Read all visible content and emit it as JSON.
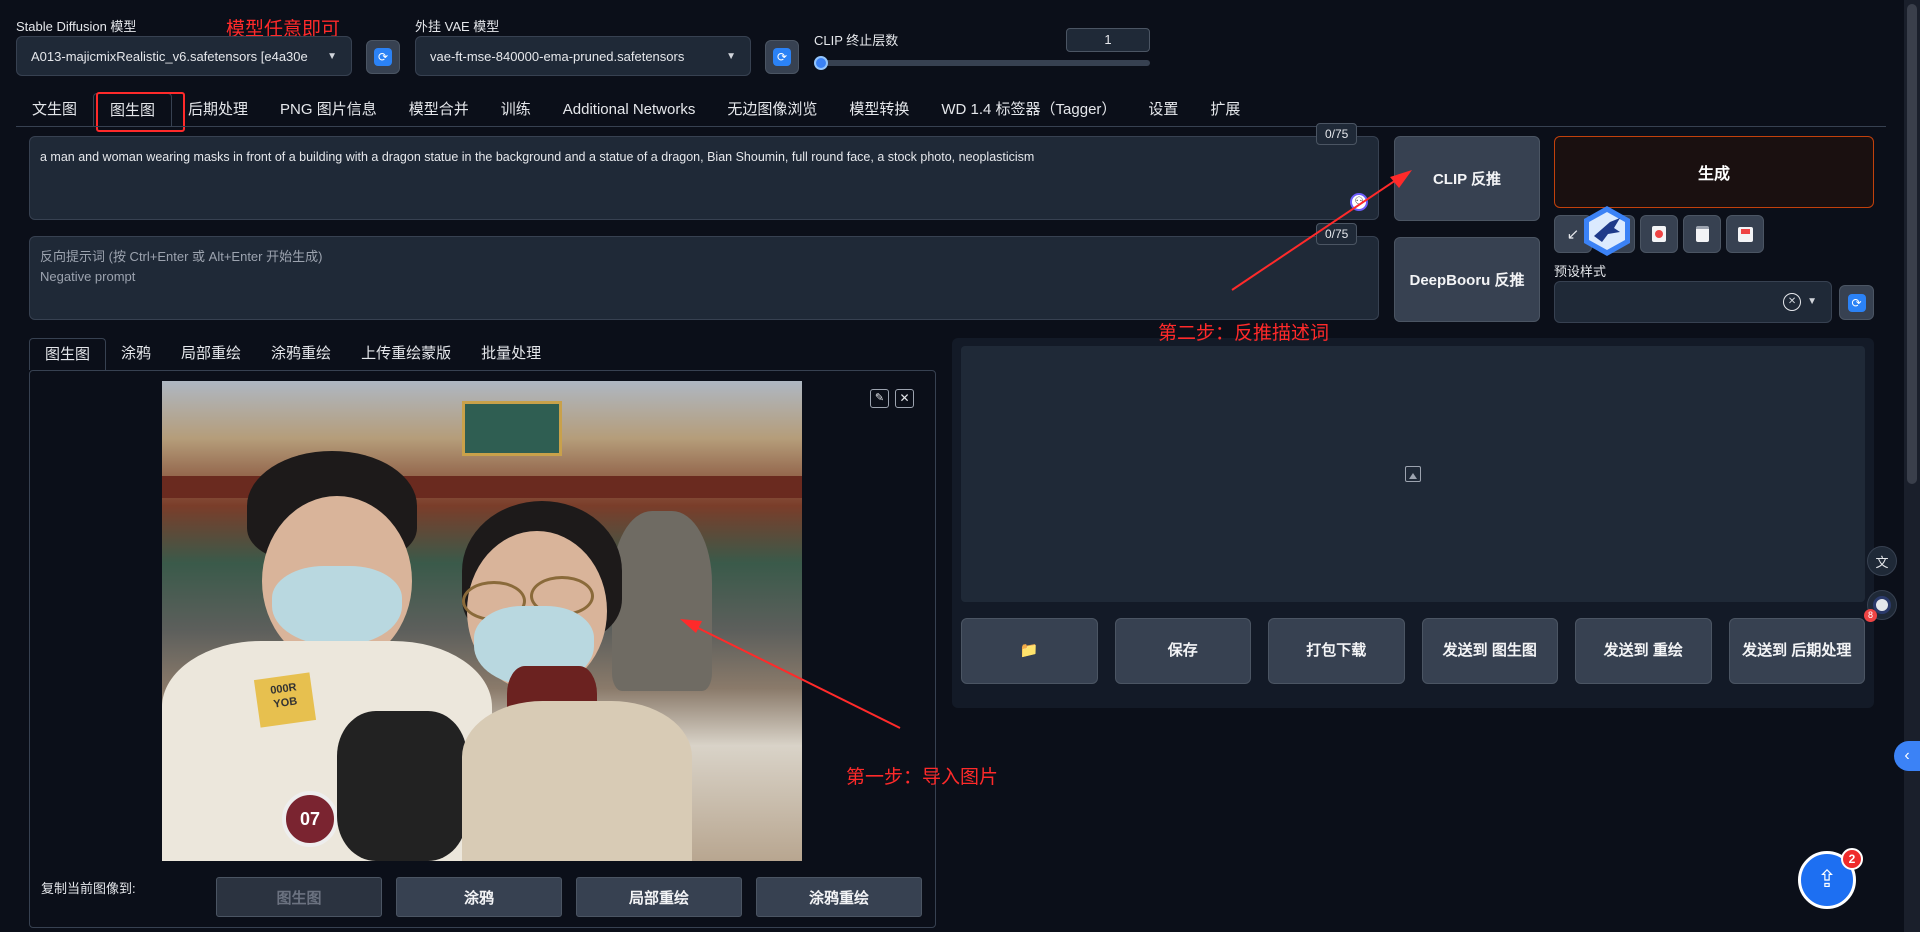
{
  "model": {
    "sd_label": "Stable Diffusion 模型",
    "sd_value": "A013-majicmixRealistic_v6.safetensors [e4a30e",
    "vae_label": "外挂 VAE 模型",
    "vae_value": "vae-ft-mse-840000-ema-pruned.safetensors",
    "clip_label": "CLIP 终止层数",
    "clip_value": "1",
    "clip_slider_fraction": 0.0
  },
  "annotations": {
    "model_note": "模型任意即可",
    "step1": "第一步：导入图片",
    "step2": "第二步：反推描述词"
  },
  "tabs": [
    {
      "label": "文生图"
    },
    {
      "label": "图生图"
    },
    {
      "label": "后期处理"
    },
    {
      "label": "PNG 图片信息"
    },
    {
      "label": "模型合并"
    },
    {
      "label": "训练"
    },
    {
      "label": "Additional Networks"
    },
    {
      "label": "无边图像浏览"
    },
    {
      "label": "模型转换"
    },
    {
      "label": "WD 1.4 标签器（Tagger）"
    },
    {
      "label": "设置"
    },
    {
      "label": "扩展"
    }
  ],
  "prompt": {
    "text": "a man and woman wearing masks in front of a building with a dragon statue in the background and a statue of a dragon, Bian Shoumin, full round face, a stock photo, neoplasticism",
    "counter": "0/75"
  },
  "negative": {
    "placeholder_line1": "反向提示词 (按 Ctrl+Enter 或 Alt+Enter 开始生成)",
    "placeholder_line2": "Negative prompt",
    "counter": "0/75"
  },
  "buttons": {
    "clip_interrogate": "CLIP 反推",
    "deepbooru_interrogate": "DeepBooru 反推",
    "generate": "生成"
  },
  "tools": {
    "icons": [
      "arrow-icon",
      "trash-icon",
      "picture-icon",
      "clipboard-icon",
      "save-icon"
    ],
    "style_label": "预设样式",
    "clear_symbol": "✕"
  },
  "subtabs": [
    {
      "label": "图生图"
    },
    {
      "label": "涂鸦"
    },
    {
      "label": "局部重绘"
    },
    {
      "label": "涂鸦重绘"
    },
    {
      "label": "上传重绘蒙版"
    },
    {
      "label": "批量处理"
    }
  ],
  "output_buttons": [
    {
      "label": "📁",
      "icon": "folder-icon"
    },
    {
      "label": "保存"
    },
    {
      "label": "打包下载"
    },
    {
      "label": "发送到 图生图"
    },
    {
      "label": "发送到 重绘"
    },
    {
      "label": "发送到 后期处理"
    }
  ],
  "copy_to": {
    "label": "复制当前图像到:",
    "buttons": [
      {
        "label": "图生图",
        "disabled": true
      },
      {
        "label": "涂鸦",
        "disabled": false
      },
      {
        "label": "局部重绘",
        "disabled": false
      },
      {
        "label": "涂鸦重绘",
        "disabled": false
      }
    ]
  },
  "photo": {
    "jacket_text_1": "000R",
    "jacket_text_2": "YOB",
    "patch_text": "07"
  },
  "badges": {
    "upload_count": "2",
    "avatar_count": "8"
  },
  "colors": {
    "accent": "#2b82f6",
    "generate_border": "#c2410c",
    "annotation": "#ff2a2a"
  }
}
